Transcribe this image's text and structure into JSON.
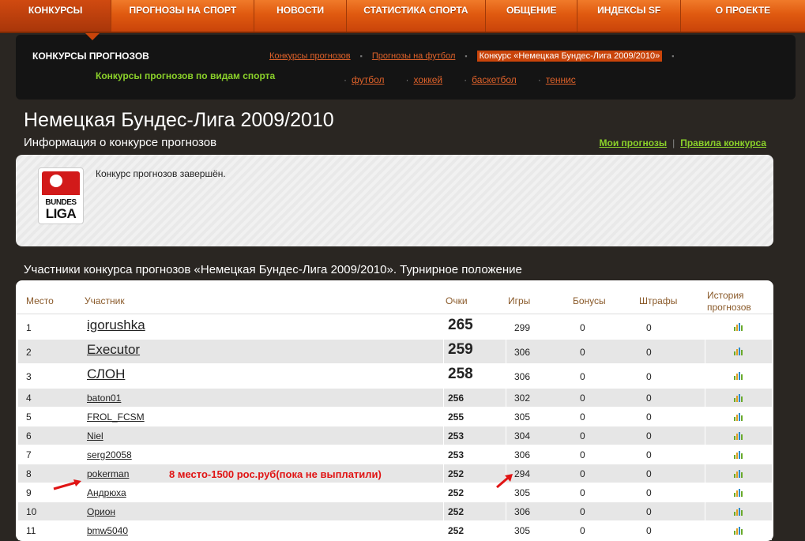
{
  "nav": {
    "items": [
      "КОНКУРСЫ",
      "ПРОГНОЗЫ НА СПОРТ",
      "НОВОСТИ",
      "СТАТИСТИКА СПОРТА",
      "ОБЩЕНИЕ",
      "ИНДЕКСЫ SF",
      "О ПРОЕКТЕ"
    ]
  },
  "subnav": {
    "title": "КОНКУРСЫ ПРОГНОЗОВ",
    "sports_title": "Конкурсы прогнозов по видам спорта",
    "breadcrumbs": [
      "Конкурсы прогнозов",
      "Прогнозы на футбол"
    ],
    "breadcrumb_current": "Конкурс «Немецкая Бундес-Лига 2009/2010»",
    "sports": [
      "футбол",
      "хоккей",
      "баскетбол",
      "теннис"
    ]
  },
  "header": {
    "title": "Немецкая Бундес-Лига 2009/2010",
    "subtitle": "Информация о конкурсе прогнозов",
    "my_forecasts": "Мои прогнозы",
    "rules": "Правила конкурса"
  },
  "info": {
    "logo_line1": "BUNDES",
    "logo_line2": "LIGA",
    "text": "Конкурс прогнозов завершён."
  },
  "table": {
    "title": "Участники конкурса прогнозов «Немецкая Бундес-Лига 2009/2010». Турнирное положение",
    "headers": {
      "place": "Место",
      "participant": "Участник",
      "points": "Очки",
      "games": "Игры",
      "bonus": "Бонусы",
      "penalty": "Штрафы",
      "history1": "История",
      "history2": "прогнозов"
    },
    "rows": [
      {
        "place": "1",
        "name": "igorushka",
        "points": "265",
        "games": "299",
        "bonus": "0",
        "penalty": "0"
      },
      {
        "place": "2",
        "name": "Executor",
        "points": "259",
        "games": "306",
        "bonus": "0",
        "penalty": "0"
      },
      {
        "place": "3",
        "name": "СЛОН",
        "points": "258",
        "games": "306",
        "bonus": "0",
        "penalty": "0"
      },
      {
        "place": "4",
        "name": "baton01",
        "points": "256",
        "games": "302",
        "bonus": "0",
        "penalty": "0"
      },
      {
        "place": "5",
        "name": "FROL_FCSM",
        "points": "255",
        "games": "305",
        "bonus": "0",
        "penalty": "0"
      },
      {
        "place": "6",
        "name": "Niel",
        "points": "253",
        "games": "304",
        "bonus": "0",
        "penalty": "0"
      },
      {
        "place": "7",
        "name": "serg20058",
        "points": "253",
        "games": "306",
        "bonus": "0",
        "penalty": "0"
      },
      {
        "place": "8",
        "name": "pokerman",
        "points": "252",
        "games": "294",
        "bonus": "0",
        "penalty": "0"
      },
      {
        "place": "9",
        "name": "Андрюха",
        "points": "252",
        "games": "305",
        "bonus": "0",
        "penalty": "0"
      },
      {
        "place": "10",
        "name": "Орион",
        "points": "252",
        "games": "306",
        "bonus": "0",
        "penalty": "0"
      },
      {
        "place": "11",
        "name": "bmw5040",
        "points": "252",
        "games": "305",
        "bonus": "0",
        "penalty": "0"
      }
    ]
  },
  "annotation": "8 место-1500 рос.руб(пока не выплатили)",
  "colors": {
    "accent": "#e05a10",
    "green": "#8bd12a",
    "annotation": "#e01414"
  }
}
